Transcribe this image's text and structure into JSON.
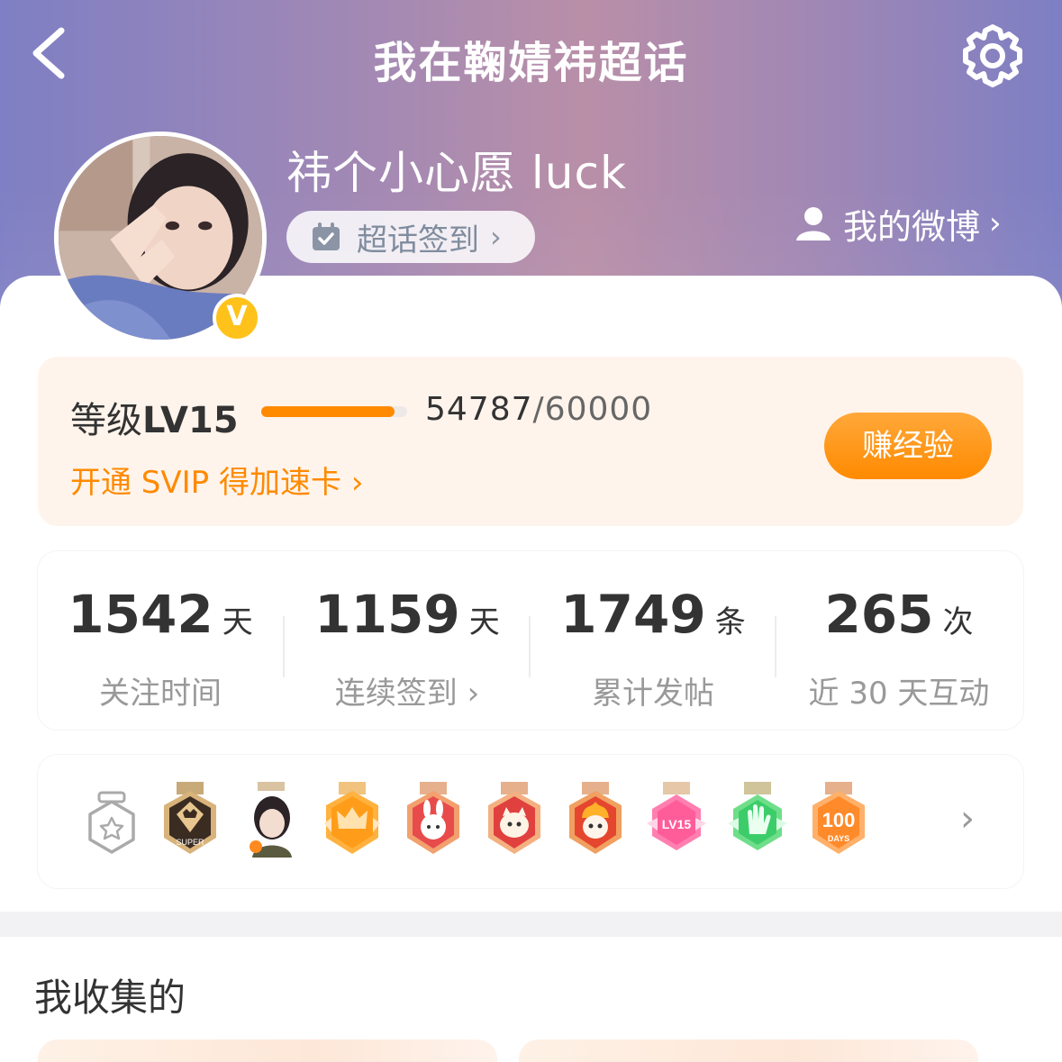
{
  "header": {
    "title": "我在鞠婧祎超话",
    "back_icon": "chevron-left-icon",
    "settings_icon": "gear-icon"
  },
  "profile": {
    "username": "祎个小心愿 luck",
    "checkin_label": "超话签到",
    "my_weibo_label": "我的微博",
    "verified_badge": "V"
  },
  "level": {
    "label": "等级",
    "level_value": "LV15",
    "progress_current": "54787",
    "progress_total": "/60000",
    "progress_fraction": 0.913,
    "svip_text": "开通 SVIP 得加速卡",
    "earn_button": "赚经验"
  },
  "stats": [
    {
      "value": "1542",
      "unit": "天",
      "label": "关注时间"
    },
    {
      "value": "1159",
      "unit": "天",
      "label": "连续签到",
      "chevron": "›"
    },
    {
      "value": "1749",
      "unit": "条",
      "label": "累计发帖"
    },
    {
      "value": "265",
      "unit": "次",
      "label": "近 30 天互动"
    }
  ],
  "badges": {
    "items": [
      "super-medal",
      "avatar-medal",
      "crown-medal",
      "red-rabbit-medal",
      "red-cat-medal",
      "fire-dragon-medal",
      "lv15-medal",
      "hand-medal",
      "100-days-medal"
    ],
    "super_text": "SUPER",
    "lv15_text": "LV15",
    "days_text": "DAYS",
    "days_number": "100"
  },
  "collection": {
    "title": "我收集的"
  },
  "colors": {
    "accent": "#ff8a00",
    "header_start": "#7e7fc4",
    "header_mid": "#b98fa8"
  }
}
